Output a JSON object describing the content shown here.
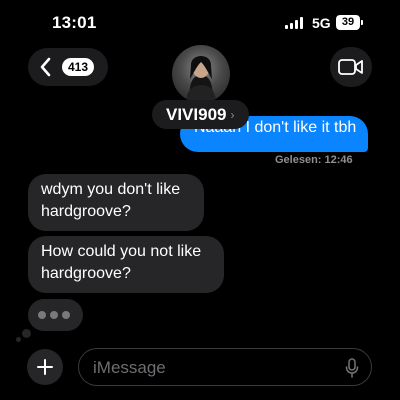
{
  "status_bar": {
    "time": "13:01",
    "network": "5G",
    "battery": "39"
  },
  "header": {
    "back_count": "413",
    "contact_name": "VIVI909",
    "name_chevron": "›",
    "icons": {
      "back": "chevron-left-icon",
      "video": "video-camera-icon"
    }
  },
  "messages": {
    "sent": [
      {
        "text": "Naaah I don't like it tbh"
      }
    ],
    "read_receipt": "Gelesen: 12:46",
    "received": [
      {
        "text": "wdym you don't like hardgroove?"
      },
      {
        "text": "How could you not like hardgroove?"
      }
    ],
    "typing_indicator": true
  },
  "composer": {
    "placeholder": "iMessage",
    "icons": {
      "add": "plus-icon",
      "mic": "microphone-icon"
    }
  },
  "colors": {
    "background": "#000000",
    "sent_bubble": "#0a84ff",
    "received_bubble": "#262628",
    "secondary_text": "#8e8e93"
  }
}
